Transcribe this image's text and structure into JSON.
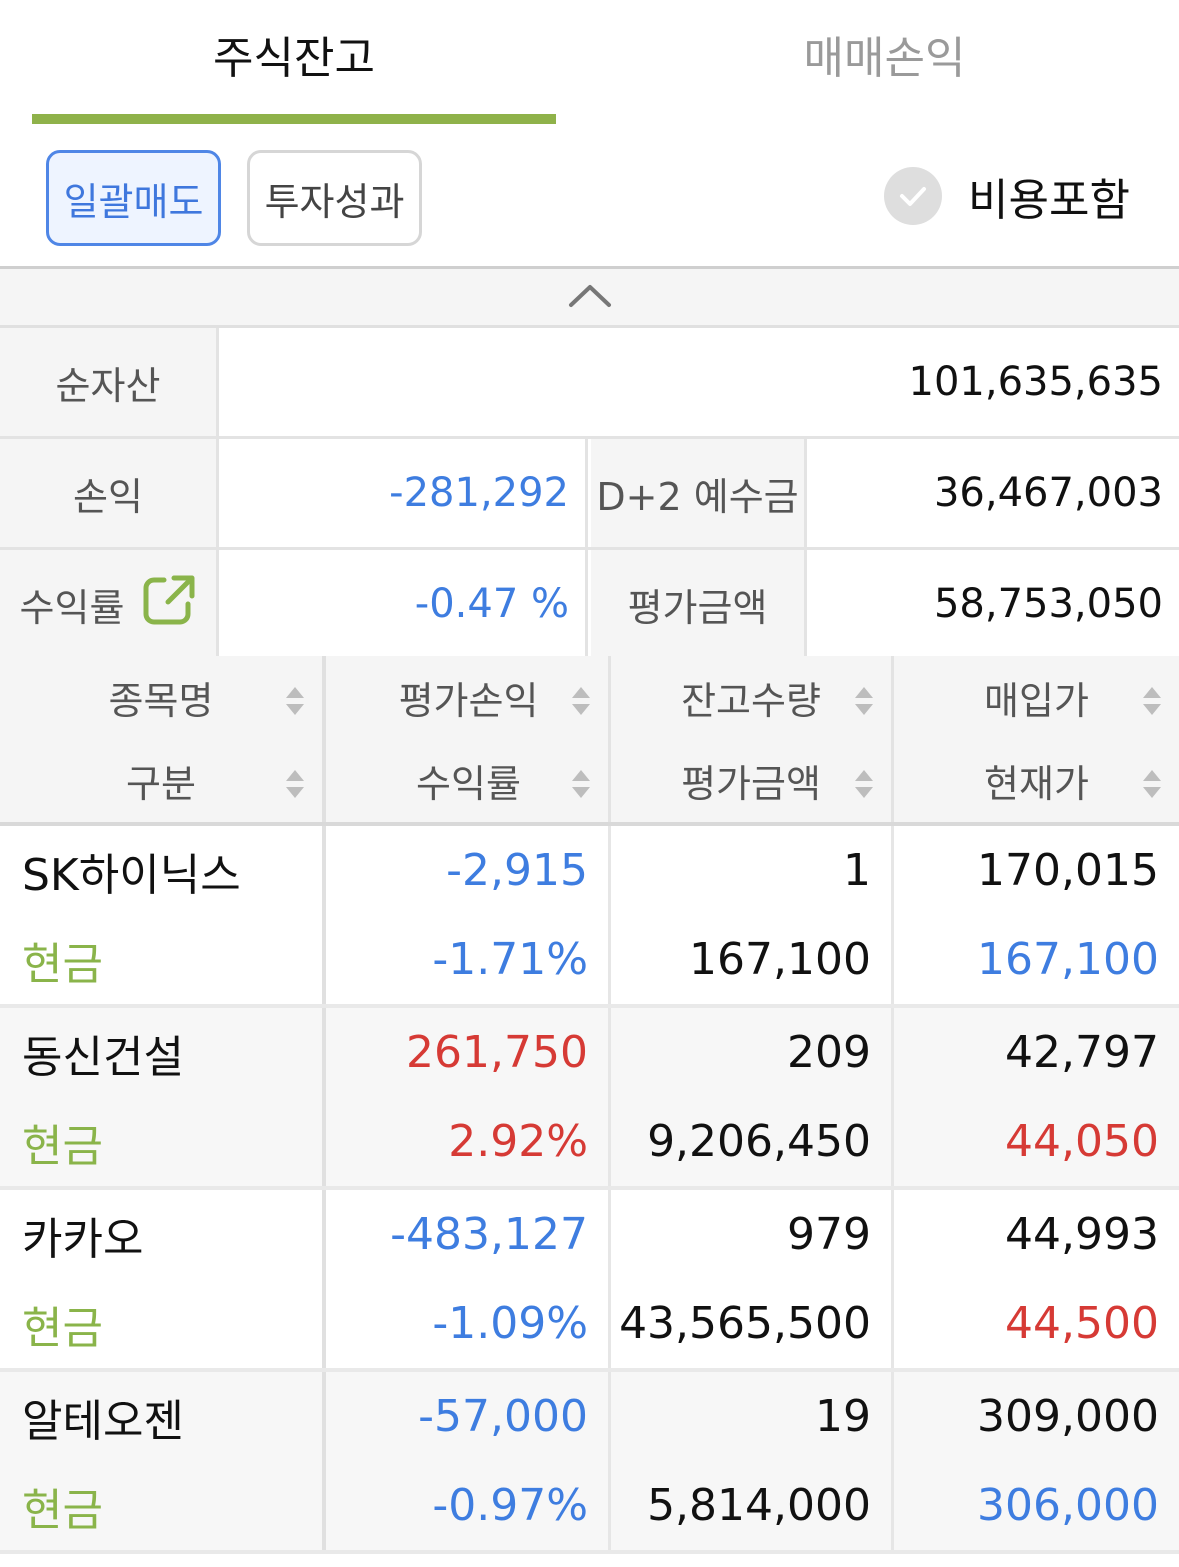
{
  "tabs": {
    "active": "주식잔고",
    "inactive": "매매손익"
  },
  "toolbar": {
    "bulk_sell": "일괄매도",
    "performance": "투자성과",
    "include_fees": "비용포함"
  },
  "summary": {
    "net_assets_label": "순자산",
    "net_assets_value": "101,635,635",
    "pnl_label": "손익",
    "pnl_value": "-281,292",
    "deposit_label": "D+2 예수금",
    "deposit_value": "36,467,003",
    "return_label": "수익률",
    "return_value": "-0.47 %",
    "eval_label": "평가금액",
    "eval_value": "58,753,050"
  },
  "table": {
    "headers": {
      "name": "종목명",
      "type": "구분",
      "eval_pnl": "평가손익",
      "return_rate": "수익률",
      "quantity": "잔고수량",
      "eval_amount": "평가금액",
      "buy_price": "매입가",
      "current_price": "현재가"
    },
    "rows": [
      {
        "name": "SK하이닉스",
        "type": "현금",
        "eval_pnl": "-2,915",
        "return_rate": "-1.71%",
        "quantity": "1",
        "eval_amount": "167,100",
        "buy_price": "170,015",
        "current_price": "167,100"
      },
      {
        "name": "동신건설",
        "type": "현금",
        "eval_pnl": "261,750",
        "return_rate": "2.92%",
        "quantity": "209",
        "eval_amount": "9,206,450",
        "buy_price": "42,797",
        "current_price": "44,050"
      },
      {
        "name": "카카오",
        "type": "현금",
        "eval_pnl": "-483,127",
        "return_rate": "-1.09%",
        "quantity": "979",
        "eval_amount": "43,565,500",
        "buy_price": "44,993",
        "current_price": "44,500"
      },
      {
        "name": "알테오젠",
        "type": "현금",
        "eval_pnl": "-57,000",
        "return_rate": "-0.97%",
        "quantity": "19",
        "eval_amount": "5,814,000",
        "buy_price": "309,000",
        "current_price": "306,000"
      }
    ]
  },
  "colors": {
    "accent_green": "#8fb24a",
    "positive_red": "#d63a35",
    "negative_blue": "#3e7de0",
    "button_blue": "#4f86e6"
  },
  "icons": {
    "collapse": "chevron-up-icon",
    "check": "check-circle-icon",
    "external": "external-link-icon",
    "sort": "sort-icon"
  }
}
